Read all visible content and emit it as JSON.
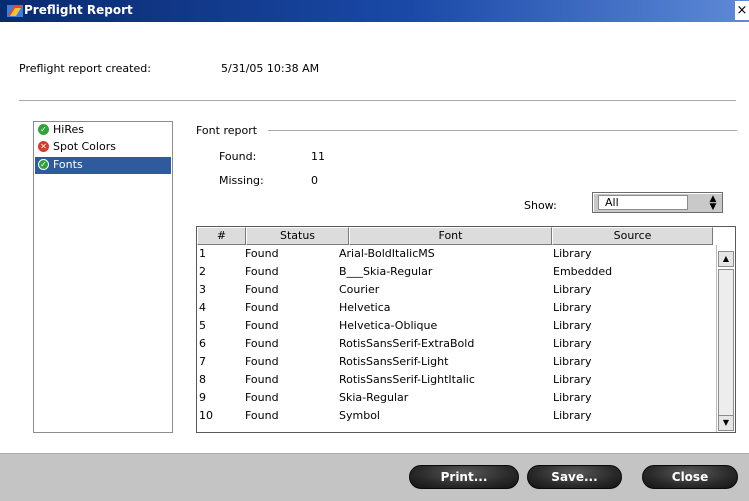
{
  "window": {
    "title": "Preflight Report",
    "close_glyph": "×",
    "app_icon": "preflight-app-icon"
  },
  "created": {
    "label": "Preflight report created:",
    "value": "5/31/05 10:38 AM"
  },
  "categories": [
    {
      "label": "HiRes",
      "status": "ok",
      "icon": "check-circle-icon"
    },
    {
      "label": "Spot Colors",
      "status": "error",
      "icon": "x-circle-icon"
    },
    {
      "label": "Fonts",
      "status": "ok",
      "icon": "check-circle-icon",
      "selected": true
    }
  ],
  "font_report": {
    "group_label": "Font report",
    "found_label": "Found:",
    "found_value": "11",
    "missing_label": "Missing:",
    "missing_value": "0"
  },
  "show": {
    "label": "Show:",
    "selected": "All"
  },
  "table": {
    "columns": [
      "#",
      "Status",
      "Font",
      "Source"
    ],
    "rows": [
      {
        "num": "1",
        "status": "Found",
        "font": "Arial-BoldItalicMS",
        "source": "Library"
      },
      {
        "num": "2",
        "status": "Found",
        "font": "B___Skia-Regular",
        "source": "Embedded"
      },
      {
        "num": "3",
        "status": "Found",
        "font": "Courier",
        "source": "Library"
      },
      {
        "num": "4",
        "status": "Found",
        "font": "Helvetica",
        "source": "Library"
      },
      {
        "num": "5",
        "status": "Found",
        "font": "Helvetica-Oblique",
        "source": "Library"
      },
      {
        "num": "6",
        "status": "Found",
        "font": "RotisSansSerif-ExtraBold",
        "source": "Library"
      },
      {
        "num": "7",
        "status": "Found",
        "font": "RotisSansSerif-Light",
        "source": "Library"
      },
      {
        "num": "8",
        "status": "Found",
        "font": "RotisSansSerif-LightItalic",
        "source": "Library"
      },
      {
        "num": "9",
        "status": "Found",
        "font": "Skia-Regular",
        "source": "Library"
      },
      {
        "num": "10",
        "status": "Found",
        "font": "Symbol",
        "source": "Library"
      }
    ]
  },
  "buttons": {
    "print": "Print...",
    "save": "Save...",
    "close": "Close"
  },
  "colors": {
    "title_bar_dark": "#0a2a6e",
    "selection": "#2f5a9e",
    "ok": "#2fa33a",
    "error": "#d63b2b",
    "footer": "#c4c4c4"
  }
}
